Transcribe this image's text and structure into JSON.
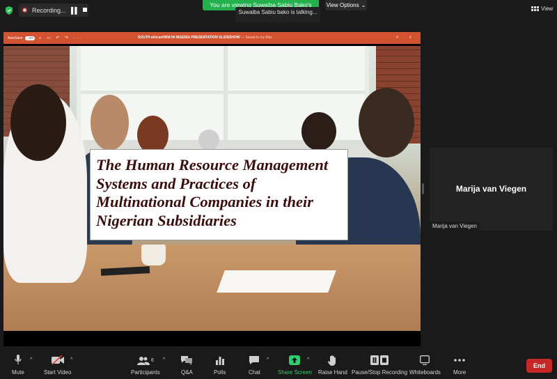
{
  "topbar": {
    "recording_label": "Recording...",
    "viewing_banner": "You are viewing Suwaiba Sabiu Bako's screen",
    "talking_indicator": "Suwaiba Sabiu bako is talking...",
    "view_options_label": "View Options",
    "view_label": "View"
  },
  "shared_app": {
    "autosave_label": "AutoSave",
    "autosave_state": "OFF",
    "doc_title": "SOUTH africanHRM IN NIGERIA PRESENTATION SLIDESHOW",
    "saved_status": "— Saved to my Mac"
  },
  "slide": {
    "title": "The Human Resource Management Systems and Practices of Multinational Companies in their Nigerian Subsidiaries"
  },
  "participant_tile": {
    "display_name": "Marija van Viegen",
    "name_label": "Marija van Viegen"
  },
  "toolbar": {
    "mute": "Mute",
    "start_video": "Start Video",
    "participants": "Participants",
    "participants_count": "6",
    "qa": "Q&A",
    "polls": "Polls",
    "chat": "Chat",
    "share_screen": "Share Screen",
    "raise_hand": "Raise Hand",
    "pause_stop_recording": "Pause/Stop Recording",
    "whiteboards": "Whiteboards",
    "more": "More",
    "end": "End"
  },
  "colors": {
    "banner_green": "#22b14c",
    "powerpoint_orange": "#d35230",
    "end_red": "#c62828",
    "title_maroon": "#3b0d0d"
  }
}
